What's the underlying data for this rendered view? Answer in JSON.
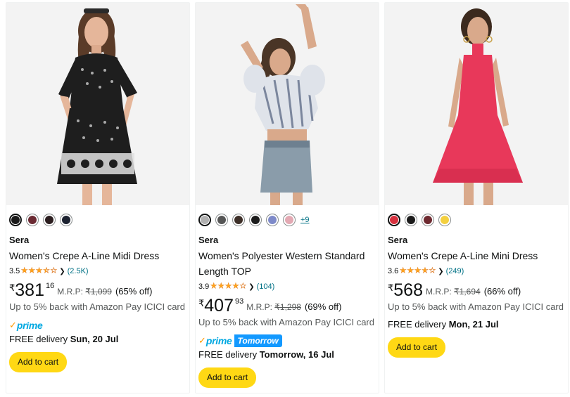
{
  "products": [
    {
      "swatches": [
        "#1a1a1a",
        "#6b2a33",
        "#2b1d1f",
        "#1c2230"
      ],
      "selected_swatch": 0,
      "more_colors": "",
      "brand": "Sera",
      "title": "Women's Crepe A-Line Midi Dress",
      "rating": "3.5",
      "rating_value": 3.5,
      "rating_count": "(2.5K)",
      "price_symbol": "₹",
      "price_whole": "381",
      "price_fraction": "16",
      "mrp_label": "M.R.P:",
      "mrp": "₹1,099",
      "discount": "(65% off)",
      "cashback": "Up to 5% back with Amazon Pay ICICI card",
      "prime_badge": "prime",
      "prime_tomorrow": "",
      "delivery_prefix": "FREE delivery",
      "delivery_date": "Sun, 20 Jul",
      "cart_label": "Add to cart"
    },
    {
      "swatches": [
        "#b0b0b0",
        "#555555",
        "#3d2f28",
        "#1c1c1c",
        "#7e8ac9",
        "#e3a9b3"
      ],
      "selected_swatch": 0,
      "more_colors": "+9",
      "brand": "Sera",
      "title": "Women's Polyester Western Standard Length TOP",
      "rating": "3.9",
      "rating_value": 3.9,
      "rating_count": "(104)",
      "price_symbol": "₹",
      "price_whole": "407",
      "price_fraction": "93",
      "mrp_label": "M.R.P:",
      "mrp": "₹1,298",
      "discount": "(69% off)",
      "cashback": "Up to 5% back with Amazon Pay ICICI card",
      "prime_badge": "prime",
      "prime_tomorrow": "Tomorrow",
      "delivery_prefix": "FREE delivery",
      "delivery_date": "Tomorrow, 16 Jul",
      "cart_label": "Add to cart"
    },
    {
      "swatches": [
        "#d7313e",
        "#1b1b1b",
        "#6e2a30",
        "#f4d03f"
      ],
      "selected_swatch": 0,
      "more_colors": "",
      "brand": "Sera",
      "title": "Women's Crepe A-Line Mini Dress",
      "rating": "3.6",
      "rating_value": 3.6,
      "rating_count": "(249)",
      "price_symbol": "₹",
      "price_whole": "568",
      "price_fraction": "",
      "mrp_label": "M.R.P:",
      "mrp": "₹1,694",
      "discount": "(66% off)",
      "cashback": "Up to 5% back with Amazon Pay ICICI card",
      "prime_badge": "",
      "prime_tomorrow": "",
      "delivery_prefix": "FREE delivery",
      "delivery_date": "Mon, 21 Jul",
      "cart_label": "Add to cart"
    }
  ],
  "colors": {
    "star": "#ffa41c",
    "link": "#007185",
    "cart_button": "#ffd814",
    "prime_blue": "#00a8e1",
    "prime_tomorrow_bg": "#1399ff"
  },
  "icons": {
    "star": "star-icon",
    "chevron": "chevron-down-icon",
    "prime_check": "prime-check-icon"
  }
}
